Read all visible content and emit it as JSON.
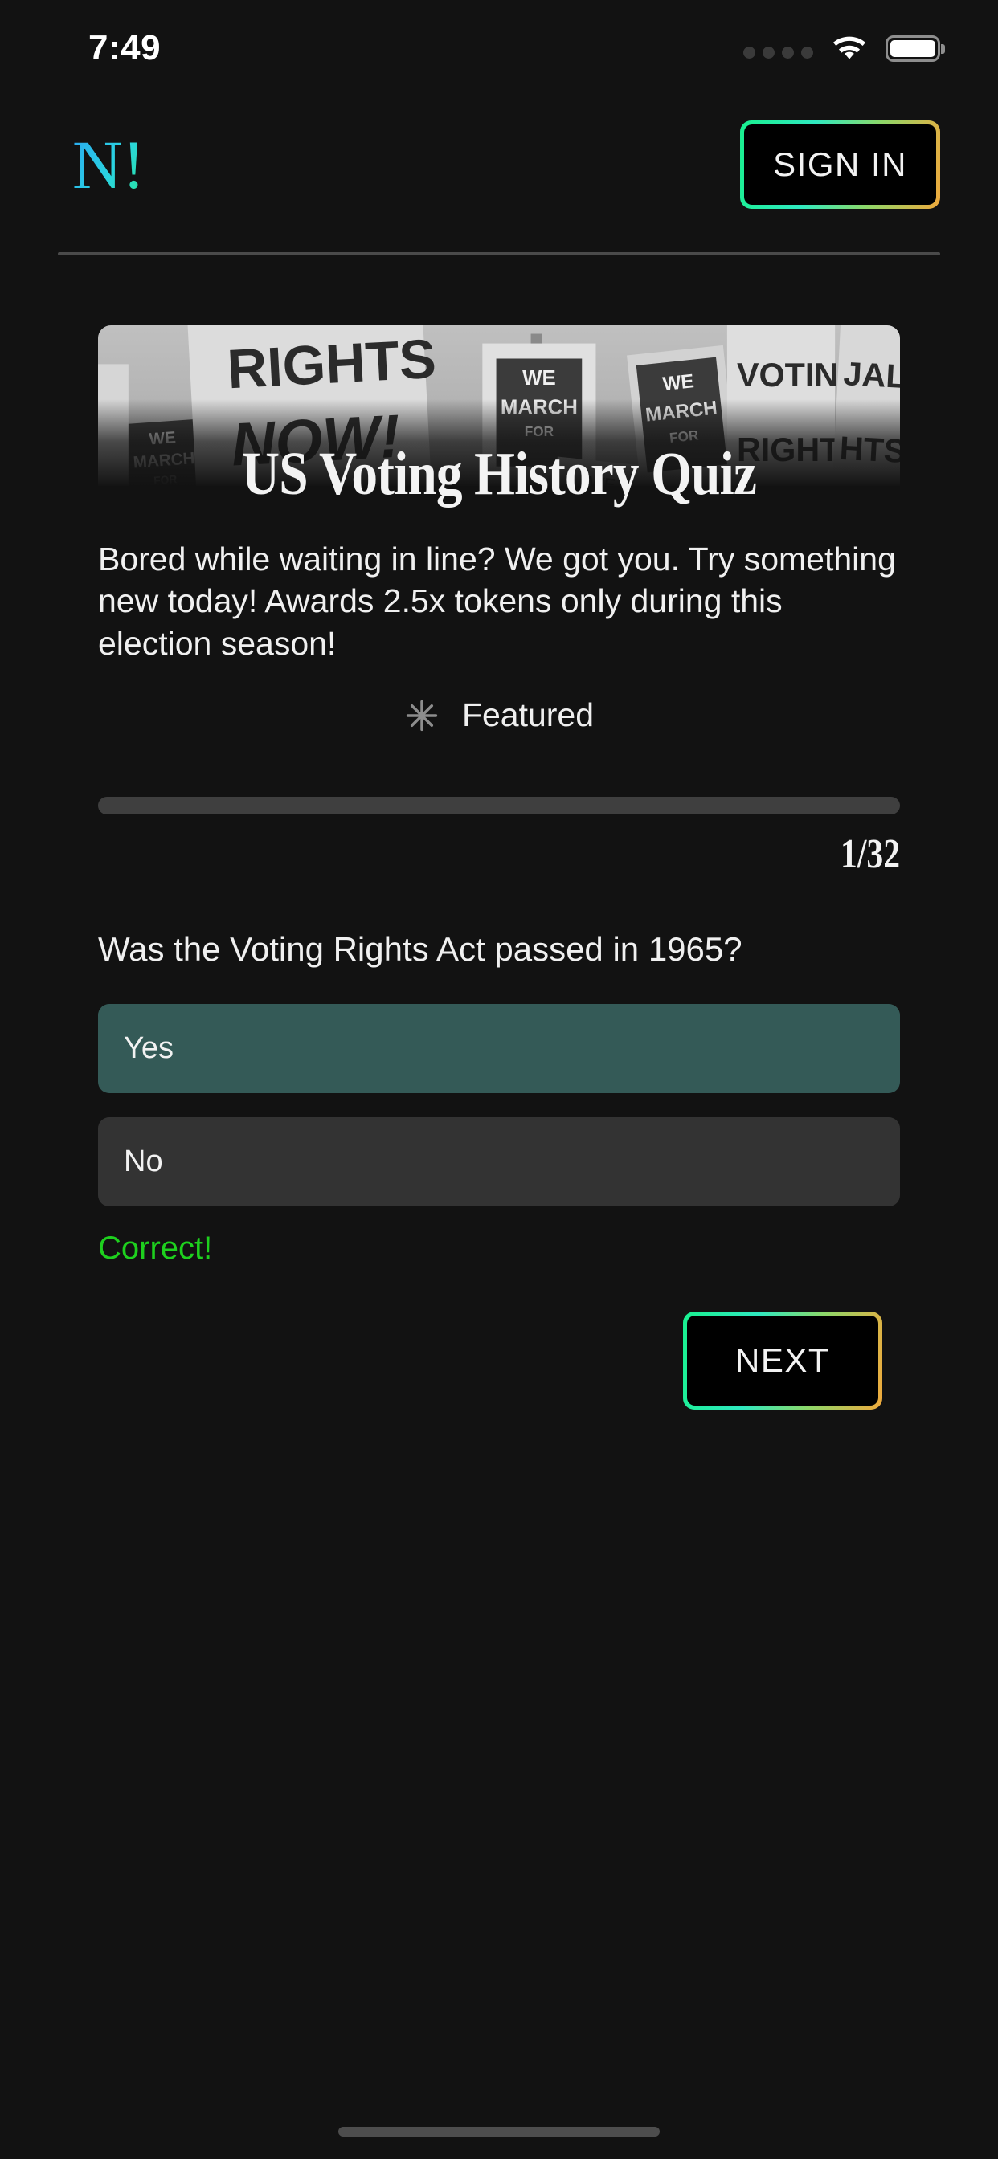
{
  "status_bar": {
    "time": "7:49",
    "signal_icon": "signal-dots-icon",
    "wifi_icon": "wifi-icon",
    "battery_icon": "battery-full-icon",
    "battery_level_percent": 100
  },
  "header": {
    "logo_text": "N!",
    "logo_gradient_from": "#2aa8f2",
    "logo_gradient_to": "#28e59a",
    "sign_in_label": "SIGN IN",
    "button_gradient_from": "#19f08f",
    "button_gradient_to": "#f0a93c"
  },
  "banner": {
    "alt": "Black and white photo of civil rights protest signs",
    "sign_texts": [
      "VOTING RIGHTS NOW!",
      "WE MARCH FOR JOBS FOR",
      "VOTING RIGHTS NOW!",
      "WE MARCH FOR",
      "JAL HTS W!"
    ]
  },
  "quiz": {
    "title": "US Voting History Quiz",
    "description": "Bored while waiting in line? We got you. Try something new today! Awards 2.5x tokens only during this election season!",
    "featured_icon": "asterisk-icon",
    "featured_label": "Featured",
    "progress": {
      "percent": 0,
      "counter": "1/32",
      "current": 1,
      "total": 32
    },
    "question": {
      "text": "Was the Voting Rights Act passed in 1965?",
      "options": [
        {
          "label": "Yes",
          "state": "selected",
          "bg": "#345a57"
        },
        {
          "label": "No",
          "state": "unselected",
          "bg": "#333333"
        }
      ],
      "feedback": "Correct!",
      "feedback_color": "#1ed01e"
    },
    "next_label": "NEXT"
  }
}
